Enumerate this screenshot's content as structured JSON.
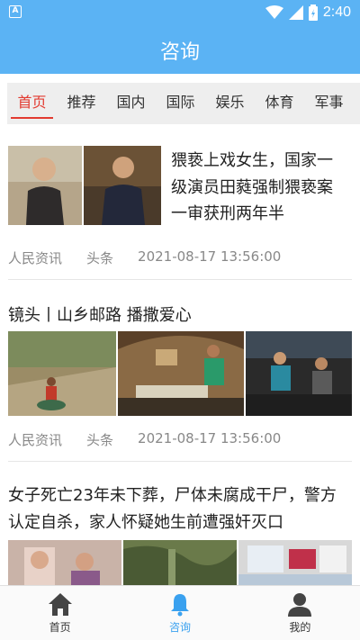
{
  "status_bar": {
    "time": "2:40",
    "app_icon": "A"
  },
  "header": {
    "title": "咨询"
  },
  "tabs": [
    {
      "label": "首页",
      "active": true
    },
    {
      "label": "推荐",
      "active": false
    },
    {
      "label": "国内",
      "active": false
    },
    {
      "label": "国际",
      "active": false
    },
    {
      "label": "娱乐",
      "active": false
    },
    {
      "label": "体育",
      "active": false
    },
    {
      "label": "军事",
      "active": false
    }
  ],
  "news": [
    {
      "title": "猥亵上戏女生，国家一级演员田蕤强制猥亵案一审获刑两年半",
      "source": "人民资讯",
      "tag": "头条",
      "time": "2021-08-17 13:56:00"
    },
    {
      "title": "镜头丨山乡邮路 播撒爱心",
      "source": "人民资讯",
      "tag": "头条",
      "time": "2021-08-17 13:56:00"
    },
    {
      "title": "女子死亡23年未下葬，尸体未腐成干尸，警方认定自杀，家人怀疑她生前遭强奸灭口"
    }
  ],
  "bottom_nav": [
    {
      "label": "首页",
      "icon": "home-icon",
      "active": false
    },
    {
      "label": "咨询",
      "icon": "bell-icon",
      "active": true
    },
    {
      "label": "我的",
      "icon": "person-icon",
      "active": false
    }
  ],
  "colors": {
    "primary": "#5bb3f4",
    "active_tab": "#e23a30",
    "nav_active": "#3aa1ef"
  }
}
